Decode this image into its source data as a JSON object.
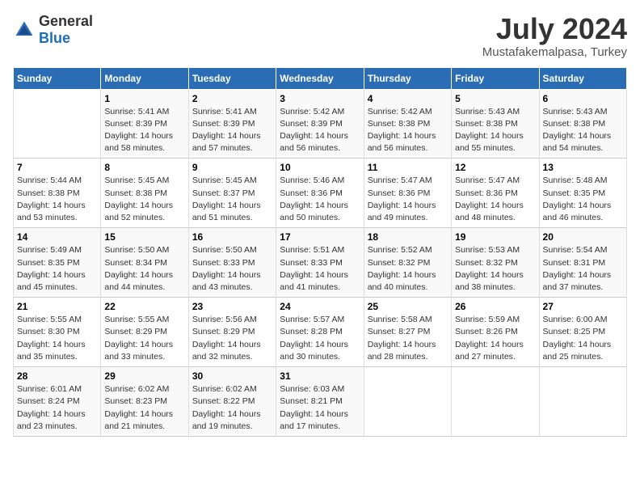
{
  "header": {
    "logo_general": "General",
    "logo_blue": "Blue",
    "month": "July 2024",
    "location": "Mustafakemalpasa, Turkey"
  },
  "weekdays": [
    "Sunday",
    "Monday",
    "Tuesday",
    "Wednesday",
    "Thursday",
    "Friday",
    "Saturday"
  ],
  "weeks": [
    [
      {
        "day": "",
        "info": ""
      },
      {
        "day": "1",
        "info": "Sunrise: 5:41 AM\nSunset: 8:39 PM\nDaylight: 14 hours\nand 58 minutes."
      },
      {
        "day": "2",
        "info": "Sunrise: 5:41 AM\nSunset: 8:39 PM\nDaylight: 14 hours\nand 57 minutes."
      },
      {
        "day": "3",
        "info": "Sunrise: 5:42 AM\nSunset: 8:39 PM\nDaylight: 14 hours\nand 56 minutes."
      },
      {
        "day": "4",
        "info": "Sunrise: 5:42 AM\nSunset: 8:38 PM\nDaylight: 14 hours\nand 56 minutes."
      },
      {
        "day": "5",
        "info": "Sunrise: 5:43 AM\nSunset: 8:38 PM\nDaylight: 14 hours\nand 55 minutes."
      },
      {
        "day": "6",
        "info": "Sunrise: 5:43 AM\nSunset: 8:38 PM\nDaylight: 14 hours\nand 54 minutes."
      }
    ],
    [
      {
        "day": "7",
        "info": "Sunrise: 5:44 AM\nSunset: 8:38 PM\nDaylight: 14 hours\nand 53 minutes."
      },
      {
        "day": "8",
        "info": "Sunrise: 5:45 AM\nSunset: 8:38 PM\nDaylight: 14 hours\nand 52 minutes."
      },
      {
        "day": "9",
        "info": "Sunrise: 5:45 AM\nSunset: 8:37 PM\nDaylight: 14 hours\nand 51 minutes."
      },
      {
        "day": "10",
        "info": "Sunrise: 5:46 AM\nSunset: 8:36 PM\nDaylight: 14 hours\nand 50 minutes."
      },
      {
        "day": "11",
        "info": "Sunrise: 5:47 AM\nSunset: 8:36 PM\nDaylight: 14 hours\nand 49 minutes."
      },
      {
        "day": "12",
        "info": "Sunrise: 5:47 AM\nSunset: 8:36 PM\nDaylight: 14 hours\nand 48 minutes."
      },
      {
        "day": "13",
        "info": "Sunrise: 5:48 AM\nSunset: 8:35 PM\nDaylight: 14 hours\nand 46 minutes."
      }
    ],
    [
      {
        "day": "14",
        "info": "Sunrise: 5:49 AM\nSunset: 8:35 PM\nDaylight: 14 hours\nand 45 minutes."
      },
      {
        "day": "15",
        "info": "Sunrise: 5:50 AM\nSunset: 8:34 PM\nDaylight: 14 hours\nand 44 minutes."
      },
      {
        "day": "16",
        "info": "Sunrise: 5:50 AM\nSunset: 8:33 PM\nDaylight: 14 hours\nand 43 minutes."
      },
      {
        "day": "17",
        "info": "Sunrise: 5:51 AM\nSunset: 8:33 PM\nDaylight: 14 hours\nand 41 minutes."
      },
      {
        "day": "18",
        "info": "Sunrise: 5:52 AM\nSunset: 8:32 PM\nDaylight: 14 hours\nand 40 minutes."
      },
      {
        "day": "19",
        "info": "Sunrise: 5:53 AM\nSunset: 8:32 PM\nDaylight: 14 hours\nand 38 minutes."
      },
      {
        "day": "20",
        "info": "Sunrise: 5:54 AM\nSunset: 8:31 PM\nDaylight: 14 hours\nand 37 minutes."
      }
    ],
    [
      {
        "day": "21",
        "info": "Sunrise: 5:55 AM\nSunset: 8:30 PM\nDaylight: 14 hours\nand 35 minutes."
      },
      {
        "day": "22",
        "info": "Sunrise: 5:55 AM\nSunset: 8:29 PM\nDaylight: 14 hours\nand 33 minutes."
      },
      {
        "day": "23",
        "info": "Sunrise: 5:56 AM\nSunset: 8:29 PM\nDaylight: 14 hours\nand 32 minutes."
      },
      {
        "day": "24",
        "info": "Sunrise: 5:57 AM\nSunset: 8:28 PM\nDaylight: 14 hours\nand 30 minutes."
      },
      {
        "day": "25",
        "info": "Sunrise: 5:58 AM\nSunset: 8:27 PM\nDaylight: 14 hours\nand 28 minutes."
      },
      {
        "day": "26",
        "info": "Sunrise: 5:59 AM\nSunset: 8:26 PM\nDaylight: 14 hours\nand 27 minutes."
      },
      {
        "day": "27",
        "info": "Sunrise: 6:00 AM\nSunset: 8:25 PM\nDaylight: 14 hours\nand 25 minutes."
      }
    ],
    [
      {
        "day": "28",
        "info": "Sunrise: 6:01 AM\nSunset: 8:24 PM\nDaylight: 14 hours\nand 23 minutes."
      },
      {
        "day": "29",
        "info": "Sunrise: 6:02 AM\nSunset: 8:23 PM\nDaylight: 14 hours\nand 21 minutes."
      },
      {
        "day": "30",
        "info": "Sunrise: 6:02 AM\nSunset: 8:22 PM\nDaylight: 14 hours\nand 19 minutes."
      },
      {
        "day": "31",
        "info": "Sunrise: 6:03 AM\nSunset: 8:21 PM\nDaylight: 14 hours\nand 17 minutes."
      },
      {
        "day": "",
        "info": ""
      },
      {
        "day": "",
        "info": ""
      },
      {
        "day": "",
        "info": ""
      }
    ]
  ]
}
